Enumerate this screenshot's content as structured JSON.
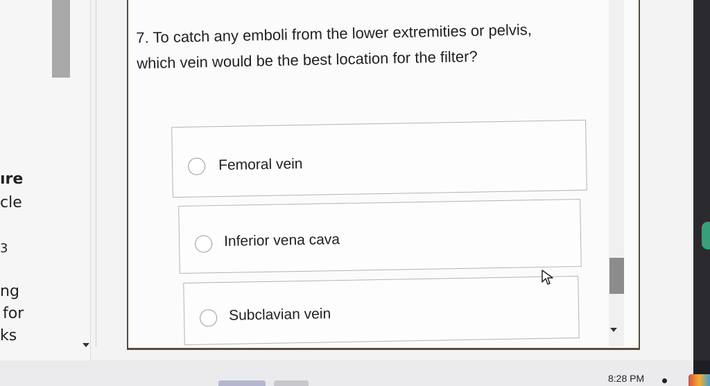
{
  "left_panel": {
    "fragments": [
      "ıre",
      "cle",
      "3",
      "ng",
      "for",
      "ks"
    ]
  },
  "question": {
    "line1": "7. To catch any emboli from the lower extremities or pelvis,",
    "line2": "which vein would be the best location for the filter?"
  },
  "options": [
    {
      "label": "Femoral vein"
    },
    {
      "label": "Inferior vena cava"
    },
    {
      "label": "Subclavian vein"
    }
  ],
  "taskbar": {
    "time": "8:28 PM"
  },
  "icons": {
    "cursor": "mouse-pointer-icon",
    "radio": "radio-circle-icon"
  }
}
